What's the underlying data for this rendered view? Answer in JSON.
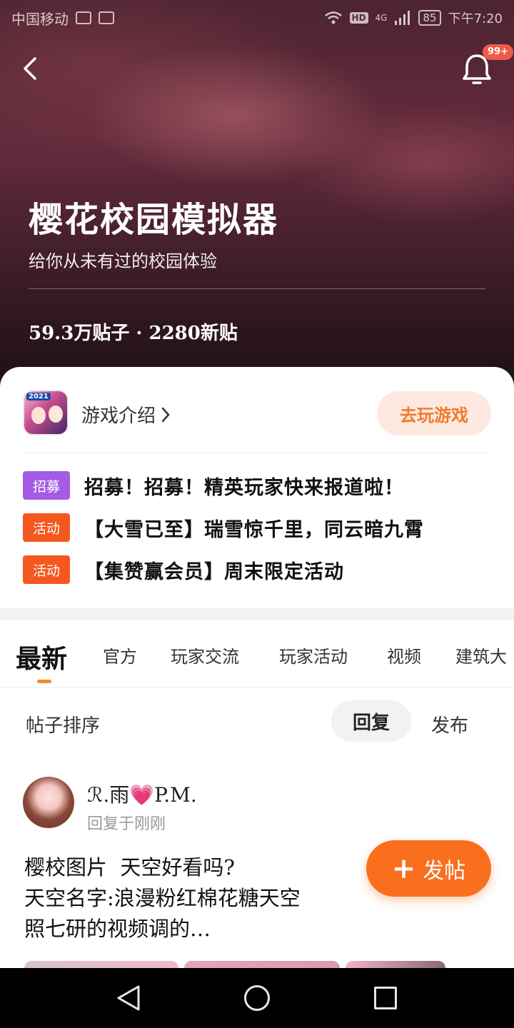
{
  "status_bar": {
    "carrier": "中国移动",
    "network": "4G",
    "hd_label": "HD",
    "battery": "85",
    "time": "下午7:20"
  },
  "header": {
    "notification_badge": "99+",
    "game_title": "樱花校园模拟器",
    "game_subtitle": "给你从未有过的校园体验",
    "stats": "59.3万贴子 · 2280新贴"
  },
  "game_card": {
    "icon_year": "2021",
    "intro_label": "游戏介绍",
    "play_button": "去玩游戏"
  },
  "notices": [
    {
      "tag": "招募",
      "tag_color": "#a55be6",
      "text": "招募！招募！精英玩家快来报道啦！"
    },
    {
      "tag": "活动",
      "tag_color": "#f5581e",
      "text": "【大雪已至】瑞雪惊千里，同云暗九霄"
    },
    {
      "tag": "活动",
      "tag_color": "#f5581e",
      "text": "【集赞赢会员】周末限定活动"
    }
  ],
  "tabs": [
    {
      "label": "最新",
      "active": true
    },
    {
      "label": "官方"
    },
    {
      "label": "玩家交流"
    },
    {
      "label": "玩家活动"
    },
    {
      "label": "视频"
    },
    {
      "label": "建筑大"
    }
  ],
  "sort": {
    "label": "帖子排序",
    "option_reply": "回复",
    "option_publish": "发布",
    "selected": "回复"
  },
  "post": {
    "username": "ℛ.雨💗P.M.",
    "time": "回复于刚刚",
    "body_lines": [
      "樱校图片  天空好看吗?",
      "天空名字:浪漫粉红棉花糖天空",
      "照七研的视频调的…"
    ]
  },
  "fab": {
    "label": "发帖"
  },
  "colors": {
    "accent": "#fa6f1e",
    "accent_soft": "#fde9df",
    "tab_indicator": "#f58a2a"
  }
}
